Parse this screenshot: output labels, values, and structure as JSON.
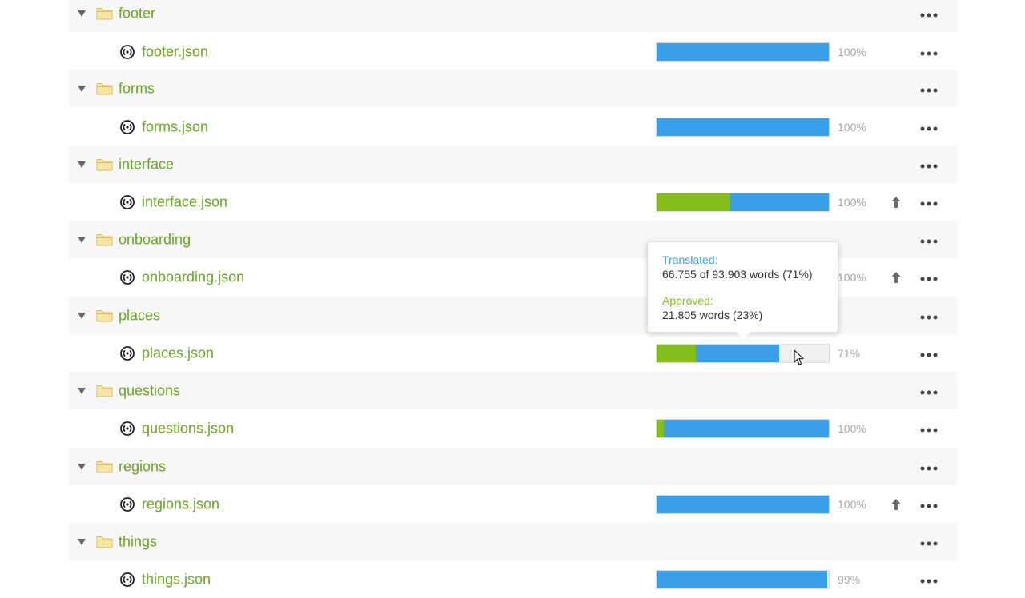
{
  "rows": [
    {
      "kind": "folder",
      "name": "footer"
    },
    {
      "kind": "file",
      "name": "footer.json",
      "approved_pct": 0,
      "translated_pct": 100,
      "percent_label": "100%",
      "upload": false
    },
    {
      "kind": "folder",
      "name": "forms"
    },
    {
      "kind": "file",
      "name": "forms.json",
      "approved_pct": 0,
      "translated_pct": 100,
      "percent_label": "100%",
      "upload": false
    },
    {
      "kind": "folder",
      "name": "interface"
    },
    {
      "kind": "file",
      "name": "interface.json",
      "approved_pct": 43,
      "translated_pct": 100,
      "percent_label": "100%",
      "upload": true
    },
    {
      "kind": "folder",
      "name": "onboarding"
    },
    {
      "kind": "file",
      "name": "onboarding.json",
      "approved_pct": 0,
      "translated_pct": 100,
      "percent_label": "100%",
      "upload": true
    },
    {
      "kind": "folder",
      "name": "places"
    },
    {
      "kind": "file",
      "name": "places.json",
      "approved_pct": 23,
      "translated_pct": 71,
      "percent_label": "71%",
      "upload": false
    },
    {
      "kind": "folder",
      "name": "questions"
    },
    {
      "kind": "file",
      "name": "questions.json",
      "approved_pct": 4,
      "translated_pct": 100,
      "percent_label": "100%",
      "upload": false
    },
    {
      "kind": "folder",
      "name": "regions"
    },
    {
      "kind": "file",
      "name": "regions.json",
      "approved_pct": 0,
      "translated_pct": 100,
      "percent_label": "100%",
      "upload": true
    },
    {
      "kind": "folder",
      "name": "things"
    },
    {
      "kind": "file",
      "name": "things.json",
      "approved_pct": 0,
      "translated_pct": 99,
      "percent_label": "99%",
      "upload": false
    }
  ],
  "tooltip": {
    "translated_label": "Translated:",
    "translated_value": "66.755 of 93.903 words (71%)",
    "approved_label": "Approved:",
    "approved_value": "21.805 words (23%)"
  },
  "icons": {
    "toggle": "triangle-down-icon",
    "folder": "folder-icon",
    "file": "json-file-icon",
    "upload": "upload-arrow-icon",
    "menu": "more-options-icon"
  },
  "colors": {
    "link_green": "#6aa524",
    "approved_green": "#84bd1a",
    "translated_blue": "#3b9ee9",
    "folder_row_bg": "#f7f7f7"
  }
}
